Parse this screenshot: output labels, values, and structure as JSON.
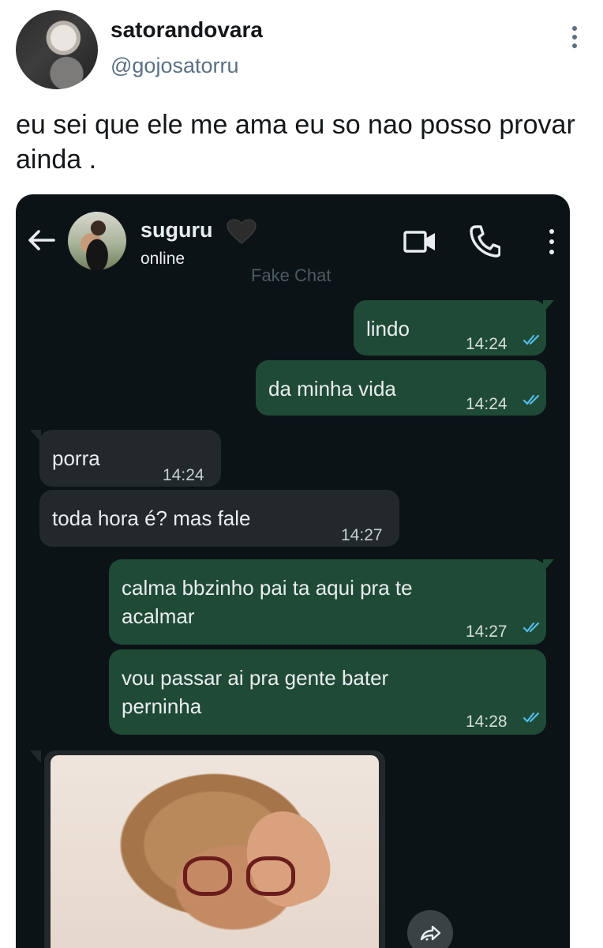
{
  "tweet": {
    "display_name": "satorandovara",
    "handle": "@gojosatorru",
    "text": "eu sei que ele me ama eu so nao posso provar ainda ."
  },
  "chat": {
    "contact_name": "suguru",
    "status": "online",
    "watermark": "Fake Chat",
    "icons": [
      "back-arrow-icon",
      "black-heart-icon",
      "video-call-icon",
      "phone-icon",
      "more-vertical-icon",
      "forward-icon"
    ],
    "messages": [
      {
        "direction": "out",
        "text": "lindo",
        "time": "14:24"
      },
      {
        "direction": "out",
        "text": "da minha vida",
        "time": "14:24"
      },
      {
        "direction": "in",
        "text": "porra",
        "time": "14:24"
      },
      {
        "direction": "in",
        "text": "toda hora é? mas fale",
        "time": "14:27"
      },
      {
        "direction": "out",
        "text": "calma bbzinho pai ta aqui pra te\nacalmar",
        "time": "14:27"
      },
      {
        "direction": "out",
        "text": "vou passar ai pra gente bater\nperninha",
        "time": "14:28"
      }
    ],
    "colors": {
      "background": "#0c1317",
      "outgoing_bubble": "#1f4a36",
      "incoming_bubble": "#22282c",
      "read_ticks": "#53bdeb"
    }
  }
}
